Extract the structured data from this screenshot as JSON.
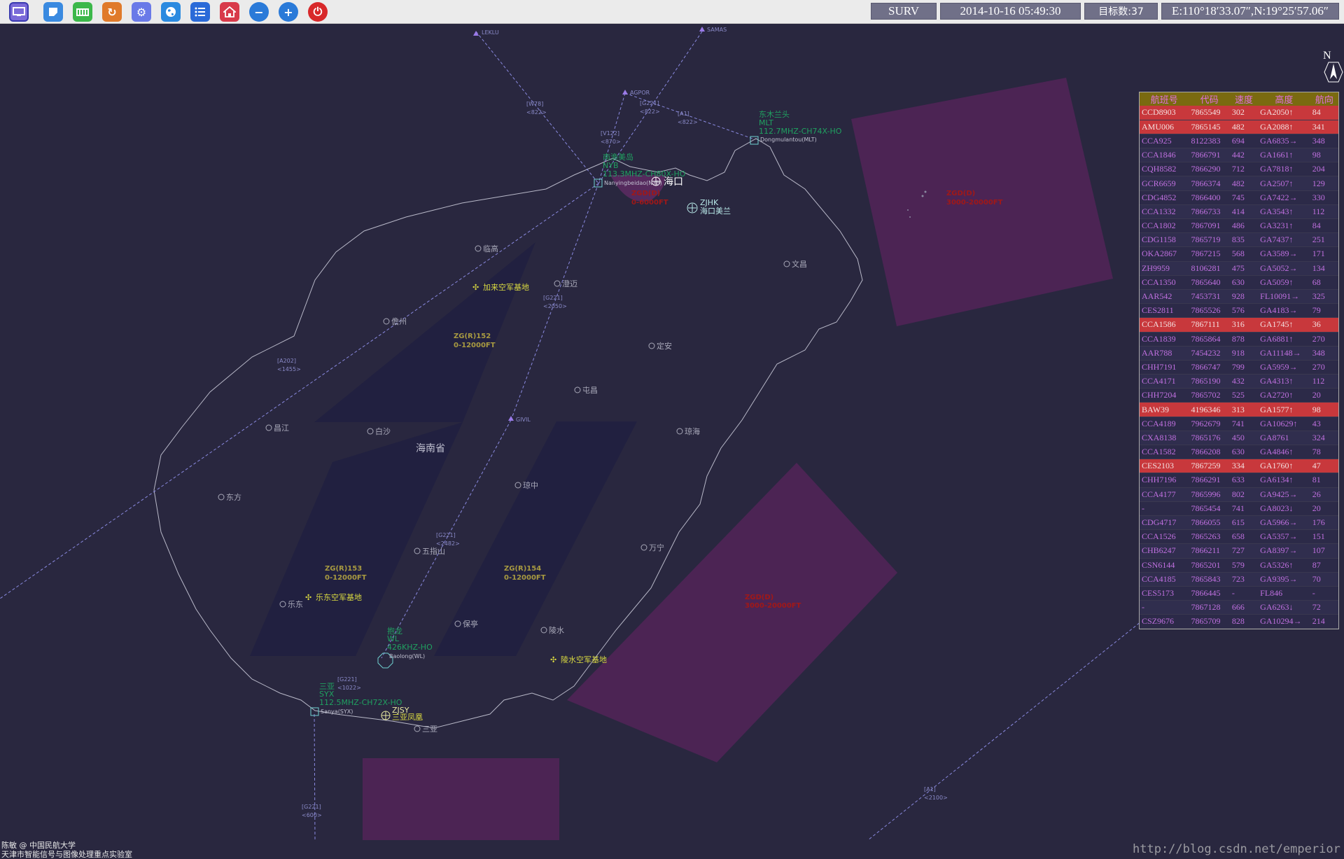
{
  "toolbar": {
    "buttons": [
      {
        "icon": "monitor-icon",
        "color": "#7a6ad8"
      },
      {
        "icon": "notepad-icon",
        "color": "#3a8ae0"
      },
      {
        "icon": "database-icon",
        "color": "#3cb84a"
      },
      {
        "icon": "refresh-icon",
        "color": "#e07a2a"
      },
      {
        "icon": "gear-icon",
        "color": "#6a7ae8"
      },
      {
        "icon": "globe-icon",
        "color": "#2a8ae0"
      },
      {
        "icon": "list-icon",
        "color": "#2a6ad8"
      },
      {
        "icon": "home-icon",
        "color": "#d83a4a"
      },
      {
        "icon": "zoom-out-icon",
        "color": "#2a7ad8"
      },
      {
        "icon": "zoom-in-icon",
        "color": "#2a7ad8"
      },
      {
        "icon": "power-icon",
        "color": "#d8282a"
      }
    ],
    "mode": "SURV",
    "datetime": "2014-10-16 05:49:30",
    "target_count": "目标数:37",
    "coordinates": "E:110°18′33.07″,N:19°25′57.06″"
  },
  "compass": {
    "north_label": "N"
  },
  "map": {
    "province_label": "海南省",
    "cities": [
      {
        "name": "临高"
      },
      {
        "name": "澄迈"
      },
      {
        "name": "儋州"
      },
      {
        "name": "定安"
      },
      {
        "name": "屯昌"
      },
      {
        "name": "文昌"
      },
      {
        "name": "琼海"
      },
      {
        "name": "白沙"
      },
      {
        "name": "昌江"
      },
      {
        "name": "东方"
      },
      {
        "name": "琼中"
      },
      {
        "name": "五指山"
      },
      {
        "name": "万宁"
      },
      {
        "name": "乐东"
      },
      {
        "name": "保亭"
      },
      {
        "name": "陵水"
      },
      {
        "name": "三亚"
      }
    ],
    "airports": [
      {
        "label": "海口"
      },
      {
        "label": "ZJHK",
        "sub": "海口美兰"
      },
      {
        "label": "ZJSY",
        "sub": "三亚凤凰"
      }
    ],
    "military_bases": [
      {
        "name": "加来空军基地"
      },
      {
        "name": "乐东空军基地"
      },
      {
        "name": "陵水空军基地"
      }
    ],
    "navaids": [
      {
        "name": "东木兰头",
        "code": "MLT",
        "freq": "112.7MHZ-CH74X-HO",
        "site": "Dongmulantou(MLT)"
      },
      {
        "name": "南渔美岛",
        "code": "NYB",
        "freq": "113.3MHZ-CH80X-HO",
        "site": "Nanyingbeidao(NYB)"
      },
      {
        "name": "抱龙",
        "code": "WL",
        "freq": "426KHZ-HO",
        "site": "Baolong(WL)"
      },
      {
        "name": "三亚",
        "code": "SYX",
        "freq": "112.5MHZ-CH72X-HO",
        "site": "Sanya(SYX)"
      }
    ],
    "waypoints": [
      "LEKLU",
      "SAMAS",
      "AGPOR",
      "GIVIL"
    ],
    "routes": [
      {
        "name": "[W78]",
        "alt": "<822>"
      },
      {
        "name": "[V122]",
        "alt": "<870>"
      },
      {
        "name": "[G221]",
        "alt": "<822>"
      },
      {
        "name": "[A1]",
        "alt": "<822>"
      },
      {
        "name": "[G221]",
        "alt": "<2050>"
      },
      {
        "name": "[A202]",
        "alt": "<1455>"
      },
      {
        "name": "[G221]",
        "alt": "<2482>"
      },
      {
        "name": "[G221]",
        "alt": "<1022>"
      },
      {
        "name": "[G221]",
        "alt": "<600>"
      },
      {
        "name": "[A1]",
        "alt": "<2100>"
      }
    ],
    "restricted_areas": [
      {
        "name": "ZG(R)152",
        "alt": "0-12000FT"
      },
      {
        "name": "ZG(R)153",
        "alt": "0-12000FT"
      },
      {
        "name": "ZG(R)154",
        "alt": "0-12000FT"
      }
    ],
    "danger_areas": [
      {
        "name": "ZGD(D)",
        "alt": "0-6000FT"
      },
      {
        "name": "ZGD(D)",
        "alt": "3000-20000FT"
      },
      {
        "name": "ZGD(D)",
        "alt": "3000-20000FT"
      }
    ]
  },
  "flight_table": {
    "headers": [
      "航班号",
      "代码",
      "速度",
      "高度",
      "航向"
    ],
    "rows": [
      {
        "callsign": "CCD8903",
        "code": "7865549",
        "speed": "302",
        "alt": "GA2050↑",
        "heading": "84",
        "alert": true
      },
      {
        "callsign": "AMU006",
        "code": "7865145",
        "speed": "482",
        "alt": "GA2088↑",
        "heading": "341",
        "alert": true
      },
      {
        "callsign": "CCA925",
        "code": "8122383",
        "speed": "694",
        "alt": "GA6835→",
        "heading": "348",
        "alert": false
      },
      {
        "callsign": "CCA1846",
        "code": "7866791",
        "speed": "442",
        "alt": "GA1661↑",
        "heading": "98",
        "alert": false
      },
      {
        "callsign": "CQH8582",
        "code": "7866290",
        "speed": "712",
        "alt": "GA7818↑",
        "heading": "204",
        "alert": false
      },
      {
        "callsign": "GCR6659",
        "code": "7866374",
        "speed": "482",
        "alt": "GA2507↑",
        "heading": "129",
        "alert": false
      },
      {
        "callsign": "CDG4852",
        "code": "7866400",
        "speed": "745",
        "alt": "GA7422→",
        "heading": "330",
        "alert": false
      },
      {
        "callsign": "CCA1332",
        "code": "7866733",
        "speed": "414",
        "alt": "GA3543↑",
        "heading": "112",
        "alert": false
      },
      {
        "callsign": "CCA1802",
        "code": "7867091",
        "speed": "486",
        "alt": "GA3231↑",
        "heading": "84",
        "alert": false
      },
      {
        "callsign": "CDG1158",
        "code": "7865719",
        "speed": "835",
        "alt": "GA7437↑",
        "heading": "251",
        "alert": false
      },
      {
        "callsign": "OKA2867",
        "code": "7867215",
        "speed": "568",
        "alt": "GA3589→",
        "heading": "171",
        "alert": false
      },
      {
        "callsign": "ZH9959",
        "code": "8106281",
        "speed": "475",
        "alt": "GA5052→",
        "heading": "134",
        "alert": false
      },
      {
        "callsign": "CCA1350",
        "code": "7865640",
        "speed": "630",
        "alt": "GA5059↑",
        "heading": "68",
        "alert": false
      },
      {
        "callsign": "AAR542",
        "code": "7453731",
        "speed": "928",
        "alt": "FL10091→",
        "heading": "325",
        "alert": false
      },
      {
        "callsign": "CES2811",
        "code": "7865526",
        "speed": "576",
        "alt": "GA4183→",
        "heading": "79",
        "alert": false
      },
      {
        "callsign": "CCA1586",
        "code": "7867111",
        "speed": "316",
        "alt": "GA1745↑",
        "heading": "36",
        "alert": true
      },
      {
        "callsign": "CCA1839",
        "code": "7865864",
        "speed": "878",
        "alt": "GA6881↑",
        "heading": "270",
        "alert": false
      },
      {
        "callsign": "AAR788",
        "code": "7454232",
        "speed": "918",
        "alt": "GA11148→",
        "heading": "348",
        "alert": false
      },
      {
        "callsign": "CHH7191",
        "code": "7866747",
        "speed": "799",
        "alt": "GA5959→",
        "heading": "270",
        "alert": false
      },
      {
        "callsign": "CCA4171",
        "code": "7865190",
        "speed": "432",
        "alt": "GA4313↑",
        "heading": "112",
        "alert": false
      },
      {
        "callsign": "CHH7204",
        "code": "7865702",
        "speed": "525",
        "alt": "GA2720↑",
        "heading": "20",
        "alert": false
      },
      {
        "callsign": "BAW39",
        "code": "4196346",
        "speed": "313",
        "alt": "GA1577↑",
        "heading": "98",
        "alert": true
      },
      {
        "callsign": "CCA4189",
        "code": "7962679",
        "speed": "741",
        "alt": "GA10629↑",
        "heading": "43",
        "alert": false
      },
      {
        "callsign": "CXA8138",
        "code": "7865176",
        "speed": "450",
        "alt": "GA8761",
        "heading": "324",
        "alert": false
      },
      {
        "callsign": "CCA1582",
        "code": "7866208",
        "speed": "630",
        "alt": "GA4846↑",
        "heading": "78",
        "alert": false
      },
      {
        "callsign": "CES2103",
        "code": "7867259",
        "speed": "334",
        "alt": "GA1760↑",
        "heading": "47",
        "alert": true
      },
      {
        "callsign": "CHH7196",
        "code": "7866291",
        "speed": "633",
        "alt": "GA6134↑",
        "heading": "81",
        "alert": false
      },
      {
        "callsign": "CCA4177",
        "code": "7865996",
        "speed": "802",
        "alt": "GA9425→",
        "heading": "26",
        "alert": false
      },
      {
        "callsign": "-",
        "code": "7865454",
        "speed": "741",
        "alt": "GA8023↓",
        "heading": "20",
        "alert": false
      },
      {
        "callsign": "CDG4717",
        "code": "7866055",
        "speed": "615",
        "alt": "GA5966→",
        "heading": "176",
        "alert": false
      },
      {
        "callsign": "CCA1526",
        "code": "7865263",
        "speed": "658",
        "alt": "GA5357→",
        "heading": "151",
        "alert": false
      },
      {
        "callsign": "CHB6247",
        "code": "7866211",
        "speed": "727",
        "alt": "GA8397→",
        "heading": "107",
        "alert": false
      },
      {
        "callsign": "CSN6144",
        "code": "7865201",
        "speed": "579",
        "alt": "GA5326↑",
        "heading": "87",
        "alert": false
      },
      {
        "callsign": "CCA4185",
        "code": "7865843",
        "speed": "723",
        "alt": "GA9395→",
        "heading": "70",
        "alert": false
      },
      {
        "callsign": "CES5173",
        "code": "7866445",
        "speed": "-",
        "alt": "FL846",
        "heading": "-",
        "alert": false
      },
      {
        "callsign": "-",
        "code": "7867128",
        "speed": "666",
        "alt": "GA6263↓",
        "heading": "72",
        "alert": false
      },
      {
        "callsign": "CSZ9676",
        "code": "7865709",
        "speed": "828",
        "alt": "GA10294→",
        "heading": "214",
        "alert": false
      }
    ]
  },
  "footer": {
    "credit_line1": "陈敏 @ 中国民航大学",
    "credit_line2": "天津市智能信号与图像处理重点实验室",
    "watermark": "http://blog.csdn.net/emperior"
  }
}
